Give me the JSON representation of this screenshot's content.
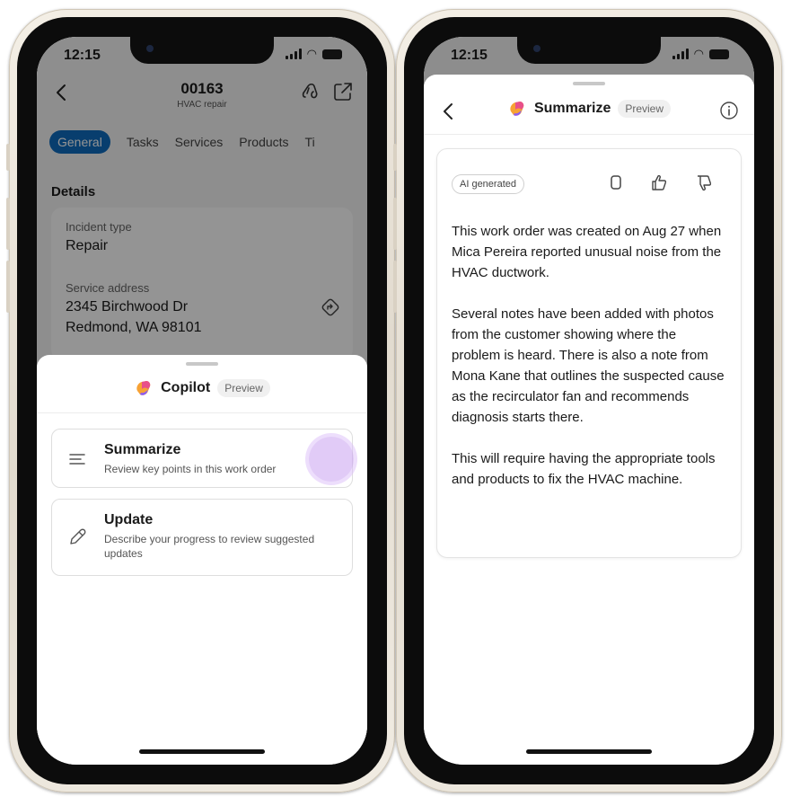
{
  "left_phone": {
    "status": {
      "time": "12:15"
    },
    "header": {
      "record_number": "00163",
      "record_type": "HVAC repair"
    },
    "tabs": [
      {
        "label": "General",
        "active": true
      },
      {
        "label": "Tasks"
      },
      {
        "label": "Services"
      },
      {
        "label": "Products"
      },
      {
        "label": "Ti"
      }
    ],
    "details": {
      "section_title": "Details",
      "incident_type_label": "Incident type",
      "incident_type_value": "Repair",
      "service_address_label": "Service address",
      "address_line1": "2345 Birchwood Dr",
      "address_line2": "Redmond, WA 98101"
    },
    "copilot_sheet": {
      "title": "Copilot",
      "preview_badge": "Preview",
      "actions": [
        {
          "icon": "lines-icon",
          "title": "Summarize",
          "description": "Review key points in this work order"
        },
        {
          "icon": "pencil-icon",
          "title": "Update",
          "description": "Describe your progress to review suggested updates"
        }
      ]
    }
  },
  "right_phone": {
    "status": {
      "time": "12:15"
    },
    "header": {
      "title": "Summarize",
      "preview_badge": "Preview"
    },
    "card": {
      "badge": "AI generated",
      "paragraphs": [
        "This work order was created on Aug 27 when Mica Pereira reported unusual noise from the HVAC ductwork.",
        "Several notes have been added with photos from the customer showing where the problem is heard. There is also a note from Mona Kane that outlines the suspected cause as the recirculator fan and recommends diagnosis starts there.",
        "This will require having the appropriate tools and products to fix the HVAC machine."
      ]
    }
  },
  "colors": {
    "accent": "#0f6cbd",
    "copilot_pink": "#e8508a",
    "copilot_orange": "#f7a234",
    "copilot_purple": "#8a5cf6",
    "touch_indicator": "#d9b8f5"
  }
}
